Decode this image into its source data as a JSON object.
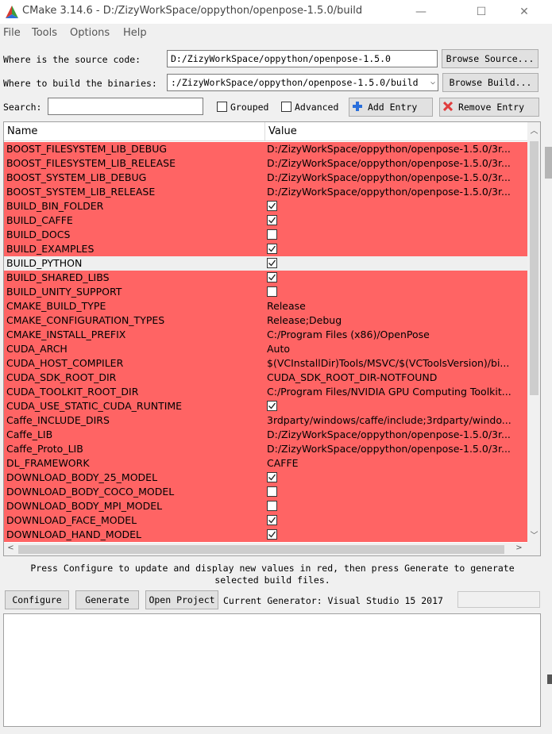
{
  "window": {
    "title": "CMake 3.14.6 - D:/ZizyWorkSpace/oppython/openpose-1.5.0/build",
    "minimize_glyph": "—",
    "maximize_glyph": "☐",
    "close_glyph": "✕"
  },
  "menu": [
    "File",
    "Tools",
    "Options",
    "Help"
  ],
  "source": {
    "label": "Where is the source code:",
    "value": "D:/ZizyWorkSpace/oppython/openpose-1.5.0",
    "browse_label": "Browse Source..."
  },
  "build": {
    "label": "Where to build the binaries:",
    "value": ":/ZizyWorkSpace/oppython/openpose-1.5.0/build",
    "browse_label": "Browse Build..."
  },
  "search": {
    "label": "Search:",
    "value": "",
    "grouped_label": "Grouped",
    "grouped_checked": false,
    "advanced_label": "Advanced",
    "advanced_checked": false,
    "add_entry_label": "Add Entry",
    "remove_entry_label": "Remove Entry"
  },
  "table": {
    "columns": [
      "Name",
      "Value"
    ],
    "rows": [
      {
        "name": "BOOST_FILESYSTEM_LIB_DEBUG",
        "type": "text",
        "value": "D:/ZizyWorkSpace/oppython/openpose-1.5.0/3r..."
      },
      {
        "name": "BOOST_FILESYSTEM_LIB_RELEASE",
        "type": "text",
        "value": "D:/ZizyWorkSpace/oppython/openpose-1.5.0/3r..."
      },
      {
        "name": "BOOST_SYSTEM_LIB_DEBUG",
        "type": "text",
        "value": "D:/ZizyWorkSpace/oppython/openpose-1.5.0/3r..."
      },
      {
        "name": "BOOST_SYSTEM_LIB_RELEASE",
        "type": "text",
        "value": "D:/ZizyWorkSpace/oppython/openpose-1.5.0/3r..."
      },
      {
        "name": "BUILD_BIN_FOLDER",
        "type": "bool",
        "checked": true
      },
      {
        "name": "BUILD_CAFFE",
        "type": "bool",
        "checked": true
      },
      {
        "name": "BUILD_DOCS",
        "type": "bool",
        "checked": false
      },
      {
        "name": "BUILD_EXAMPLES",
        "type": "bool",
        "checked": true
      },
      {
        "name": "BUILD_PYTHON",
        "type": "bool",
        "checked": true,
        "selected": true
      },
      {
        "name": "BUILD_SHARED_LIBS",
        "type": "bool",
        "checked": true
      },
      {
        "name": "BUILD_UNITY_SUPPORT",
        "type": "bool",
        "checked": false
      },
      {
        "name": "CMAKE_BUILD_TYPE",
        "type": "text",
        "value": "Release"
      },
      {
        "name": "CMAKE_CONFIGURATION_TYPES",
        "type": "text",
        "value": "Release;Debug"
      },
      {
        "name": "CMAKE_INSTALL_PREFIX",
        "type": "text",
        "value": "C:/Program Files (x86)/OpenPose"
      },
      {
        "name": "CUDA_ARCH",
        "type": "text",
        "value": "Auto"
      },
      {
        "name": "CUDA_HOST_COMPILER",
        "type": "text",
        "value": "$(VCInstallDir)Tools/MSVC/$(VCToolsVersion)/bi..."
      },
      {
        "name": "CUDA_SDK_ROOT_DIR",
        "type": "text",
        "value": "CUDA_SDK_ROOT_DIR-NOTFOUND"
      },
      {
        "name": "CUDA_TOOLKIT_ROOT_DIR",
        "type": "text",
        "value": "C:/Program Files/NVIDIA GPU Computing Toolkit..."
      },
      {
        "name": "CUDA_USE_STATIC_CUDA_RUNTIME",
        "type": "bool",
        "checked": true
      },
      {
        "name": "Caffe_INCLUDE_DIRS",
        "type": "text",
        "value": "3rdparty/windows/caffe/include;3rdparty/windo..."
      },
      {
        "name": "Caffe_LIB",
        "type": "text",
        "value": "D:/ZizyWorkSpace/oppython/openpose-1.5.0/3r..."
      },
      {
        "name": "Caffe_Proto_LIB",
        "type": "text",
        "value": "D:/ZizyWorkSpace/oppython/openpose-1.5.0/3r..."
      },
      {
        "name": "DL_FRAMEWORK",
        "type": "text",
        "value": "CAFFE"
      },
      {
        "name": "DOWNLOAD_BODY_25_MODEL",
        "type": "bool",
        "checked": true
      },
      {
        "name": "DOWNLOAD_BODY_COCO_MODEL",
        "type": "bool",
        "checked": false
      },
      {
        "name": "DOWNLOAD_BODY_MPI_MODEL",
        "type": "bool",
        "checked": false
      },
      {
        "name": "DOWNLOAD_FACE_MODEL",
        "type": "bool",
        "checked": true
      },
      {
        "name": "DOWNLOAD_HAND_MODEL",
        "type": "bool",
        "checked": true
      }
    ]
  },
  "hint": "Press Configure to update and display new values in red, then press Generate to generate selected build files.",
  "actions": {
    "configure_label": "Configure",
    "generate_label": "Generate",
    "open_project_label": "Open Project",
    "generator_text": "Current Generator: Visual Studio 15 2017"
  },
  "output_log": "",
  "colors": {
    "changed_row": "#ff6464",
    "selected_row": "#efefef",
    "cmake_logo_red": "#d63a2f",
    "cmake_logo_blue": "#2a6fdb",
    "cmake_logo_green": "#3c9c3c"
  },
  "icons": {
    "app": "cmake-triangle-icon",
    "add_entry": "plus-icon",
    "remove_entry": "red-x-icon"
  }
}
